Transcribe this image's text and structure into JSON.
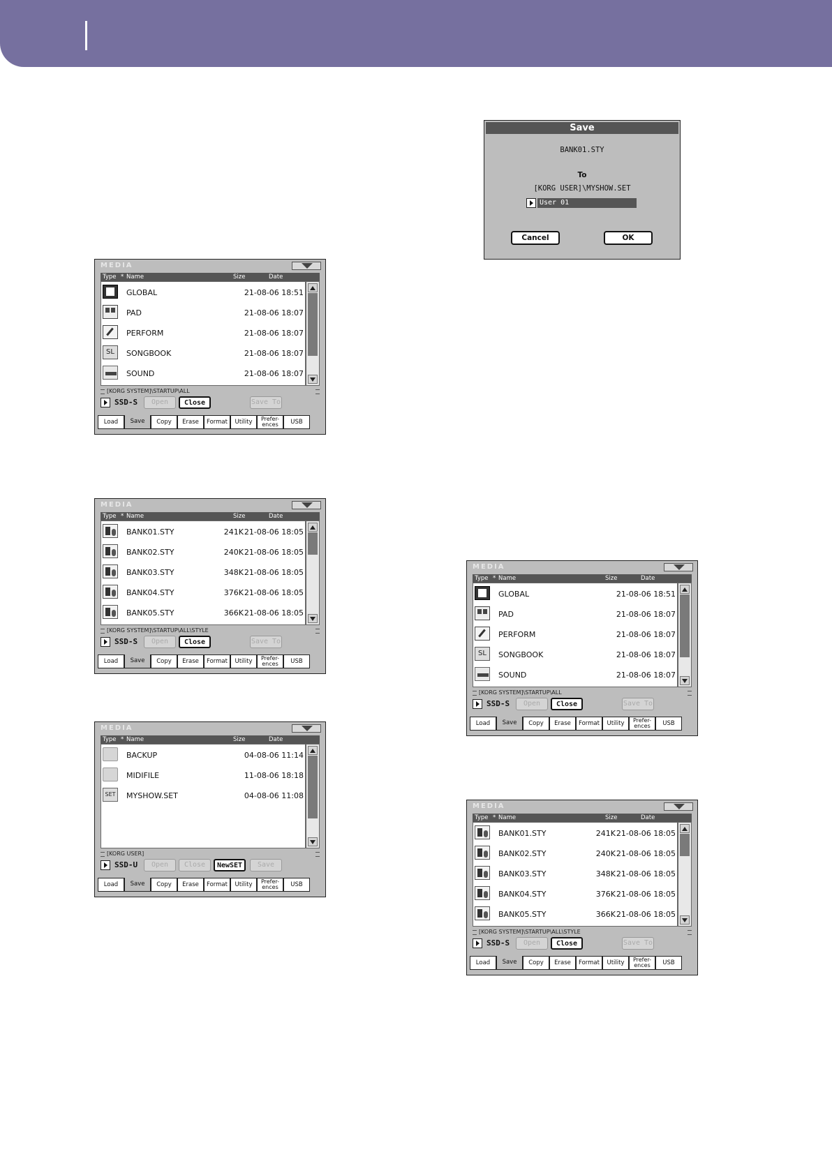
{
  "tabs": [
    "Load",
    "Save",
    "Copy",
    "Erase",
    "Format",
    "Utility",
    "Prefer-\nences",
    "USB"
  ],
  "columns": {
    "type": "Type",
    "star": "*",
    "name": "Name",
    "size": "Size",
    "date": "Date"
  },
  "window_title": "MEDIA",
  "windows": [
    {
      "path": "[KORG SYSTEM]\\STARTUP\\ALL",
      "device": "SSD-S",
      "buttons": [
        "Open",
        "Close",
        "",
        "Save To"
      ],
      "rows": [
        {
          "icon": "global-icon",
          "name": "GLOBAL",
          "size": "",
          "date": "21-08-06 18:51"
        },
        {
          "icon": "pad-icon",
          "name": "PAD",
          "size": "",
          "date": "21-08-06 18:07"
        },
        {
          "icon": "perform-icon",
          "name": "PERFORM",
          "size": "",
          "date": "21-08-06 18:07"
        },
        {
          "icon": "songbook-icon",
          "name": "SONGBOOK",
          "size": "",
          "date": "21-08-06 18:07"
        },
        {
          "icon": "sound-icon",
          "name": "SOUND",
          "size": "",
          "date": "21-08-06 18:07"
        }
      ]
    },
    {
      "path": "[KORG SYSTEM]\\STARTUP\\ALL\\STYLE",
      "device": "SSD-S",
      "buttons": [
        "Open",
        "Close",
        "",
        "Save To"
      ],
      "rows": [
        {
          "icon": "style-icon",
          "name": "BANK01.STY",
          "size": "241K",
          "date": "21-08-06 18:05"
        },
        {
          "icon": "style-icon",
          "name": "BANK02.STY",
          "size": "240K",
          "date": "21-08-06 18:05"
        },
        {
          "icon": "style-icon",
          "name": "BANK03.STY",
          "size": "348K",
          "date": "21-08-06 18:05"
        },
        {
          "icon": "style-icon",
          "name": "BANK04.STY",
          "size": "376K",
          "date": "21-08-06 18:05"
        },
        {
          "icon": "style-icon",
          "name": "BANK05.STY",
          "size": "366K",
          "date": "21-08-06 18:05"
        }
      ]
    },
    {
      "path": "[KORG USER]",
      "device": "SSD-U",
      "buttons": [
        "Open",
        "Close",
        "NewSET",
        "Save"
      ],
      "rows": [
        {
          "icon": "folder-icon",
          "name": "BACKUP",
          "size": "",
          "date": "04-08-06 11:14"
        },
        {
          "icon": "folder-icon",
          "name": "MIDIFILE",
          "size": "",
          "date": "11-08-06 18:18"
        },
        {
          "icon": "set-icon",
          "name": "MYSHOW.SET",
          "size": "",
          "date": "04-08-06 11:08"
        }
      ]
    },
    {
      "path": "[KORG SYSTEM]\\STARTUP\\ALL",
      "device": "SSD-S",
      "buttons": [
        "Open",
        "Close",
        "",
        "Save To"
      ],
      "rows": [
        {
          "icon": "global-icon",
          "name": "GLOBAL",
          "size": "",
          "date": "21-08-06 18:51"
        },
        {
          "icon": "pad-icon",
          "name": "PAD",
          "size": "",
          "date": "21-08-06 18:07"
        },
        {
          "icon": "perform-icon",
          "name": "PERFORM",
          "size": "",
          "date": "21-08-06 18:07"
        },
        {
          "icon": "songbook-icon",
          "name": "SONGBOOK",
          "size": "",
          "date": "21-08-06 18:07"
        },
        {
          "icon": "sound-icon",
          "name": "SOUND",
          "size": "",
          "date": "21-08-06 18:07"
        }
      ]
    },
    {
      "path": "[KORG SYSTEM]\\STARTUP\\ALL\\STYLE",
      "device": "SSD-S",
      "buttons": [
        "Open",
        "Close",
        "",
        "Save To"
      ],
      "rows": [
        {
          "icon": "style-icon",
          "name": "BANK01.STY",
          "size": "241K",
          "date": "21-08-06 18:05"
        },
        {
          "icon": "style-icon",
          "name": "BANK02.STY",
          "size": "240K",
          "date": "21-08-06 18:05"
        },
        {
          "icon": "style-icon",
          "name": "BANK03.STY",
          "size": "348K",
          "date": "21-08-06 18:05"
        },
        {
          "icon": "style-icon",
          "name": "BANK04.STY",
          "size": "376K",
          "date": "21-08-06 18:05"
        },
        {
          "icon": "style-icon",
          "name": "BANK05.STY",
          "size": "366K",
          "date": "21-08-06 18:05"
        }
      ]
    }
  ],
  "save_dialog": {
    "title": "Save",
    "file": "BANK01.STY",
    "to_label": "To",
    "destination": "[KORG USER]\\MYSHOW.SET",
    "slot": "User 01",
    "cancel": "Cancel",
    "ok": "OK"
  },
  "colors": {
    "header": "#76709f",
    "panel": "#bdbdbd",
    "bar": "#555555"
  }
}
